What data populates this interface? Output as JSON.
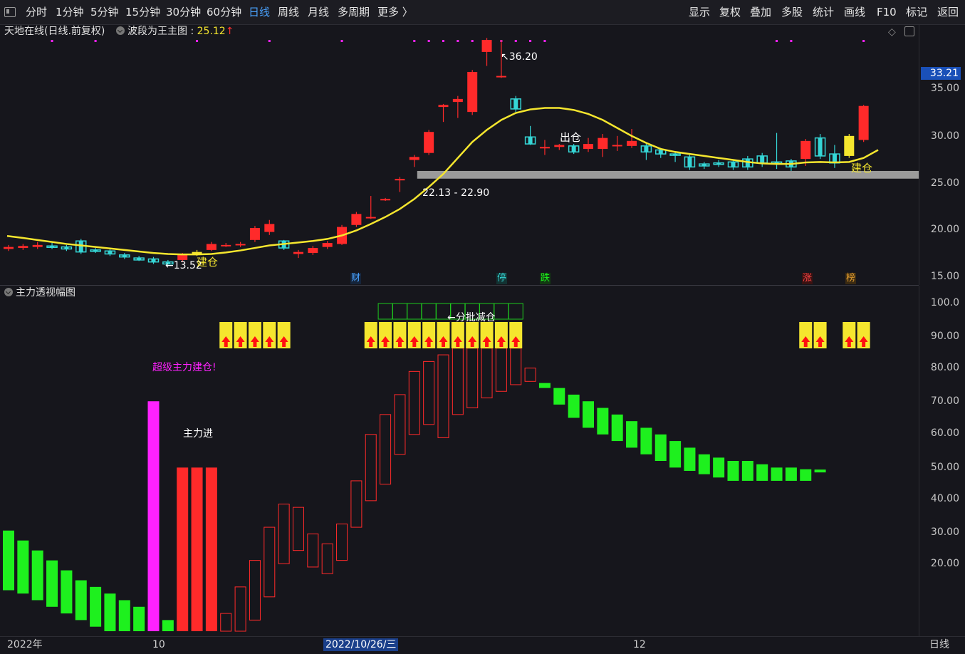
{
  "toolbar": {
    "left": [
      "分时",
      "1分钟",
      "5分钟",
      "15分钟",
      "30分钟",
      "60分钟",
      "日线",
      "周线",
      "月线",
      "多周期",
      "更多 〉"
    ],
    "active": "日线",
    "right": [
      "显示",
      "复权",
      "叠加",
      "多股",
      "统计",
      "画线",
      "F10",
      "标记",
      "返回"
    ]
  },
  "main_panel": {
    "stock_title": "天地在线(日线.前复权)",
    "indicator_name": "波段为王主图",
    "indicator_value": "25.12",
    "y_ticks": [
      "35.00",
      "30.00",
      "25.00",
      "20.00",
      "15.00"
    ],
    "current_price": "33.21",
    "annotations": {
      "high": "36.20",
      "low": "13.52",
      "sell": "出仓",
      "buy1": "建仓",
      "buy2": "建仓",
      "support": "22.13 - 22.90"
    },
    "markers": [
      "财",
      "停",
      "跌",
      "涨",
      "榜"
    ]
  },
  "sub_panel": {
    "title": "主力透视幅图",
    "y_ticks": [
      "100.0",
      "90.00",
      "80.00",
      "70.00",
      "60.00",
      "50.00",
      "40.00",
      "30.00",
      "20.00"
    ],
    "annotations": {
      "super_build": "超级主力建仓!",
      "main_in": "主力进",
      "batch_reduce": "←分批减仓"
    }
  },
  "date_axis": {
    "labels": [
      "2022年",
      "10",
      "2022/10/26/三",
      "12"
    ],
    "period": "日线"
  },
  "chart_data": [
    {
      "type": "candlestick",
      "ylim": [
        11.5,
        37.5
      ],
      "candles": [
        {
          "o": 15.1,
          "c": 15.3,
          "h": 15.5,
          "l": 14.9
        },
        {
          "o": 15.2,
          "c": 15.4,
          "h": 15.6,
          "l": 15.0
        },
        {
          "o": 15.3,
          "c": 15.5,
          "h": 15.8,
          "l": 15.1
        },
        {
          "o": 15.4,
          "c": 15.3,
          "h": 15.7,
          "l": 15.1
        },
        {
          "o": 15.3,
          "c": 15.1,
          "h": 15.5,
          "l": 14.9
        },
        {
          "o": 15.9,
          "c": 14.8,
          "h": 16.1,
          "l": 14.6
        },
        {
          "o": 15.0,
          "c": 14.9,
          "h": 15.2,
          "l": 14.7
        },
        {
          "o": 14.9,
          "c": 14.6,
          "h": 15.1,
          "l": 14.4
        },
        {
          "o": 14.5,
          "c": 14.3,
          "h": 14.7,
          "l": 14.1
        },
        {
          "o": 14.2,
          "c": 14.0,
          "h": 14.4,
          "l": 13.9
        },
        {
          "o": 14.1,
          "c": 13.8,
          "h": 14.3,
          "l": 13.6
        },
        {
          "o": 13.8,
          "c": 13.6,
          "h": 14.0,
          "l": 13.52
        },
        {
          "o": 14.0,
          "c": 14.5,
          "h": 14.7,
          "l": 13.8
        },
        {
          "o": 14.6,
          "c": 14.8,
          "h": 15.0,
          "l": 14.4
        },
        {
          "o": 15.0,
          "c": 15.6,
          "h": 15.8,
          "l": 14.9
        },
        {
          "o": 15.4,
          "c": 15.5,
          "h": 15.7,
          "l": 15.3
        },
        {
          "o": 15.5,
          "c": 15.6,
          "h": 15.8,
          "l": 15.3
        },
        {
          "o": 16.0,
          "c": 17.2,
          "h": 17.4,
          "l": 15.8
        },
        {
          "o": 16.8,
          "c": 17.6,
          "h": 18.0,
          "l": 16.5
        },
        {
          "o": 15.9,
          "c": 15.2,
          "h": 16.0,
          "l": 15.0
        },
        {
          "o": 14.6,
          "c": 14.8,
          "h": 15.0,
          "l": 14.2
        },
        {
          "o": 14.7,
          "c": 15.2,
          "h": 15.4,
          "l": 14.5
        },
        {
          "o": 15.3,
          "c": 15.7,
          "h": 15.9,
          "l": 15.1
        },
        {
          "o": 15.6,
          "c": 17.3,
          "h": 17.5,
          "l": 15.5
        },
        {
          "o": 17.5,
          "c": 18.6,
          "h": 18.8,
          "l": 17.3
        },
        {
          "o": 18.2,
          "c": 18.3,
          "h": 20.4,
          "l": 18.1
        },
        {
          "o": 20.0,
          "c": 20.1,
          "h": 20.2,
          "l": 19.9
        },
        {
          "o": 22.0,
          "c": 22.1,
          "h": 22.3,
          "l": 20.8
        },
        {
          "o": 24.0,
          "c": 24.3,
          "h": 24.5,
          "l": 23.3
        },
        {
          "o": 24.7,
          "c": 26.8,
          "h": 27.0,
          "l": 24.5
        },
        {
          "o": 29.3,
          "c": 29.5,
          "h": 29.6,
          "l": 27.8
        },
        {
          "o": 29.8,
          "c": 30.1,
          "h": 30.4,
          "l": 28.2
        },
        {
          "o": 28.8,
          "c": 32.8,
          "h": 33.0,
          "l": 28.5
        },
        {
          "o": 34.8,
          "c": 36.0,
          "h": 36.2,
          "l": 33.4
        },
        {
          "o": 32.3,
          "c": 32.4,
          "h": 36.0,
          "l": 32.2
        },
        {
          "o": 30.1,
          "c": 29.1,
          "h": 30.4,
          "l": 28.8
        },
        {
          "o": 26.3,
          "c": 25.6,
          "h": 27.4,
          "l": 25.5
        },
        {
          "o": 25.2,
          "c": 25.3,
          "h": 26.0,
          "l": 24.5
        },
        {
          "o": 25.3,
          "c": 25.5,
          "h": 25.6,
          "l": 25.0
        },
        {
          "o": 25.4,
          "c": 24.8,
          "h": 25.6,
          "l": 24.6
        },
        {
          "o": 25.1,
          "c": 25.6,
          "h": 26.2,
          "l": 24.8
        },
        {
          "o": 25.1,
          "c": 26.2,
          "h": 26.6,
          "l": 24.3
        },
        {
          "o": 25.4,
          "c": 25.5,
          "h": 26.4,
          "l": 24.9
        },
        {
          "o": 25.4,
          "c": 25.9,
          "h": 27.1,
          "l": 25.2
        },
        {
          "o": 25.4,
          "c": 24.8,
          "h": 25.6,
          "l": 24.0
        },
        {
          "o": 25.0,
          "c": 24.6,
          "h": 25.2,
          "l": 24.2
        },
        {
          "o": 24.6,
          "c": 24.5,
          "h": 24.8,
          "l": 23.8
        },
        {
          "o": 24.3,
          "c": 23.3,
          "h": 24.5,
          "l": 23.0
        },
        {
          "o": 23.6,
          "c": 23.4,
          "h": 23.8,
          "l": 23.1
        },
        {
          "o": 23.7,
          "c": 23.6,
          "h": 24.0,
          "l": 23.3
        },
        {
          "o": 23.8,
          "c": 23.3,
          "h": 24.0,
          "l": 23.0
        },
        {
          "o": 24.1,
          "c": 23.3,
          "h": 24.4,
          "l": 23.0
        },
        {
          "o": 24.4,
          "c": 23.7,
          "h": 24.7,
          "l": 23.3
        },
        {
          "o": 23.8,
          "c": 23.7,
          "h": 26.7,
          "l": 23.1
        },
        {
          "o": 23.9,
          "c": 23.3,
          "h": 24.1,
          "l": 22.9
        },
        {
          "o": 24.1,
          "c": 25.9,
          "h": 26.1,
          "l": 23.4
        },
        {
          "o": 26.2,
          "c": 24.4,
          "h": 26.6,
          "l": 24.1
        },
        {
          "o": 24.6,
          "c": 23.7,
          "h": 25.5,
          "l": 23.2
        },
        {
          "o": 24.4,
          "c": 26.4,
          "h": 26.6,
          "l": 24.2
        },
        {
          "o": 26.0,
          "c": 29.4,
          "h": 29.5,
          "l": 25.8
        }
      ],
      "ma": [
        16.4,
        16.2,
        16.0,
        15.8,
        15.6,
        15.45,
        15.3,
        15.15,
        15.0,
        14.85,
        14.7,
        14.6,
        14.55,
        14.55,
        14.6,
        14.75,
        14.95,
        15.2,
        15.45,
        15.6,
        15.75,
        15.9,
        16.1,
        16.45,
        16.95,
        17.6,
        18.3,
        19.1,
        20.1,
        21.3,
        22.6,
        24.2,
        25.8,
        27.0,
        28.0,
        28.7,
        29.05,
        29.2,
        29.2,
        29.0,
        28.6,
        28.0,
        27.2,
        26.4,
        25.7,
        25.1,
        24.8,
        24.6,
        24.4,
        24.2,
        24.0,
        23.8,
        23.65,
        23.6,
        23.6,
        23.75,
        23.8,
        23.75,
        23.8,
        24.2,
        25.0
      ],
      "support_band": [
        22.13,
        22.9
      ]
    },
    {
      "type": "bar",
      "title": "主力透视幅图",
      "ylim": [
        0,
        104
      ],
      "bars": [
        {
          "t": "g",
          "lo": 13,
          "hi": 31
        },
        {
          "t": "g",
          "lo": 12,
          "hi": 28
        },
        {
          "t": "g",
          "lo": 10,
          "hi": 25
        },
        {
          "t": "g",
          "lo": 8,
          "hi": 22
        },
        {
          "t": "g",
          "lo": 6,
          "hi": 19
        },
        {
          "t": "g",
          "lo": 4,
          "hi": 16
        },
        {
          "t": "g",
          "lo": 2,
          "hi": 14
        },
        {
          "t": "g",
          "lo": 0,
          "hi": 12
        },
        {
          "t": "g",
          "lo": -2,
          "hi": 10
        },
        {
          "t": "g",
          "lo": -4,
          "hi": 8
        },
        {
          "t": "m",
          "lo": -10,
          "hi": 70
        },
        {
          "t": "g",
          "lo": -2,
          "hi": 4
        },
        {
          "t": "r",
          "lo": -10,
          "hi": 50
        },
        {
          "t": "r",
          "lo": -10,
          "hi": 50
        },
        {
          "t": "r",
          "lo": -10,
          "hi": 50
        },
        {
          "t": "ro",
          "lo": -4,
          "hi": 6
        },
        {
          "t": "ro",
          "lo": 0,
          "hi": 14
        },
        {
          "t": "ro",
          "lo": 4,
          "hi": 22
        },
        {
          "t": "ro",
          "lo": 11,
          "hi": 32
        },
        {
          "t": "ro",
          "lo": 21,
          "hi": 39
        },
        {
          "t": "ro",
          "lo": 25,
          "hi": 38
        },
        {
          "t": "ro",
          "lo": 20,
          "hi": 30
        },
        {
          "t": "ro",
          "lo": 18,
          "hi": 27
        },
        {
          "t": "ro",
          "lo": 22,
          "hi": 33
        },
        {
          "t": "ro",
          "lo": 32,
          "hi": 46
        },
        {
          "t": "ro",
          "lo": 40,
          "hi": 60
        },
        {
          "t": "ro",
          "lo": 45,
          "hi": 66
        },
        {
          "t": "ro",
          "lo": 54,
          "hi": 72
        },
        {
          "t": "ro",
          "lo": 60,
          "hi": 79
        },
        {
          "t": "ro",
          "lo": 63,
          "hi": 82
        },
        {
          "t": "ro",
          "lo": 59,
          "hi": 84
        },
        {
          "t": "ro",
          "lo": 66,
          "hi": 86
        },
        {
          "t": "ro",
          "lo": 68,
          "hi": 86
        },
        {
          "t": "ro",
          "lo": 71,
          "hi": 86
        },
        {
          "t": "ro",
          "lo": 73,
          "hi": 86
        },
        {
          "t": "ro",
          "lo": 75,
          "hi": 86
        },
        {
          "t": "ro",
          "lo": 76,
          "hi": 80
        },
        {
          "t": "g",
          "lo": 74,
          "hi": 75.5
        },
        {
          "t": "g",
          "lo": 69,
          "hi": 74
        },
        {
          "t": "g",
          "lo": 65,
          "hi": 72
        },
        {
          "t": "g",
          "lo": 62,
          "hi": 70
        },
        {
          "t": "g",
          "lo": 60,
          "hi": 68
        },
        {
          "t": "g",
          "lo": 58,
          "hi": 66
        },
        {
          "t": "g",
          "lo": 56,
          "hi": 64
        },
        {
          "t": "g",
          "lo": 54,
          "hi": 62
        },
        {
          "t": "g",
          "lo": 52,
          "hi": 60
        },
        {
          "t": "g",
          "lo": 50,
          "hi": 58
        },
        {
          "t": "g",
          "lo": 49,
          "hi": 56
        },
        {
          "t": "g",
          "lo": 48,
          "hi": 54
        },
        {
          "t": "g",
          "lo": 47,
          "hi": 53
        },
        {
          "t": "g",
          "lo": 46,
          "hi": 52
        },
        {
          "t": "g",
          "lo": 46,
          "hi": 52
        },
        {
          "t": "g",
          "lo": 46,
          "hi": 51
        },
        {
          "t": "g",
          "lo": 46,
          "hi": 50
        },
        {
          "t": "g",
          "lo": 46,
          "hi": 50
        },
        {
          "t": "g",
          "lo": 46,
          "hi": 49.5
        },
        {
          "t": "g",
          "lo": 48.8,
          "hi": 49.4
        }
      ],
      "signal_boxes_idx": [
        15,
        16,
        17,
        18,
        19,
        25,
        26,
        27,
        28,
        29,
        30,
        31,
        32,
        33,
        34,
        35,
        55,
        56,
        58,
        59
      ],
      "outline_boxes_idx": [
        26,
        27,
        28,
        29,
        30,
        31,
        32,
        33,
        34,
        35
      ]
    }
  ],
  "colors": {
    "red": "#ff2a2a",
    "cyan": "#35d6d6",
    "yellow": "#f5e62e",
    "green": "#1ef01e",
    "magenta": "#ff22ff"
  }
}
